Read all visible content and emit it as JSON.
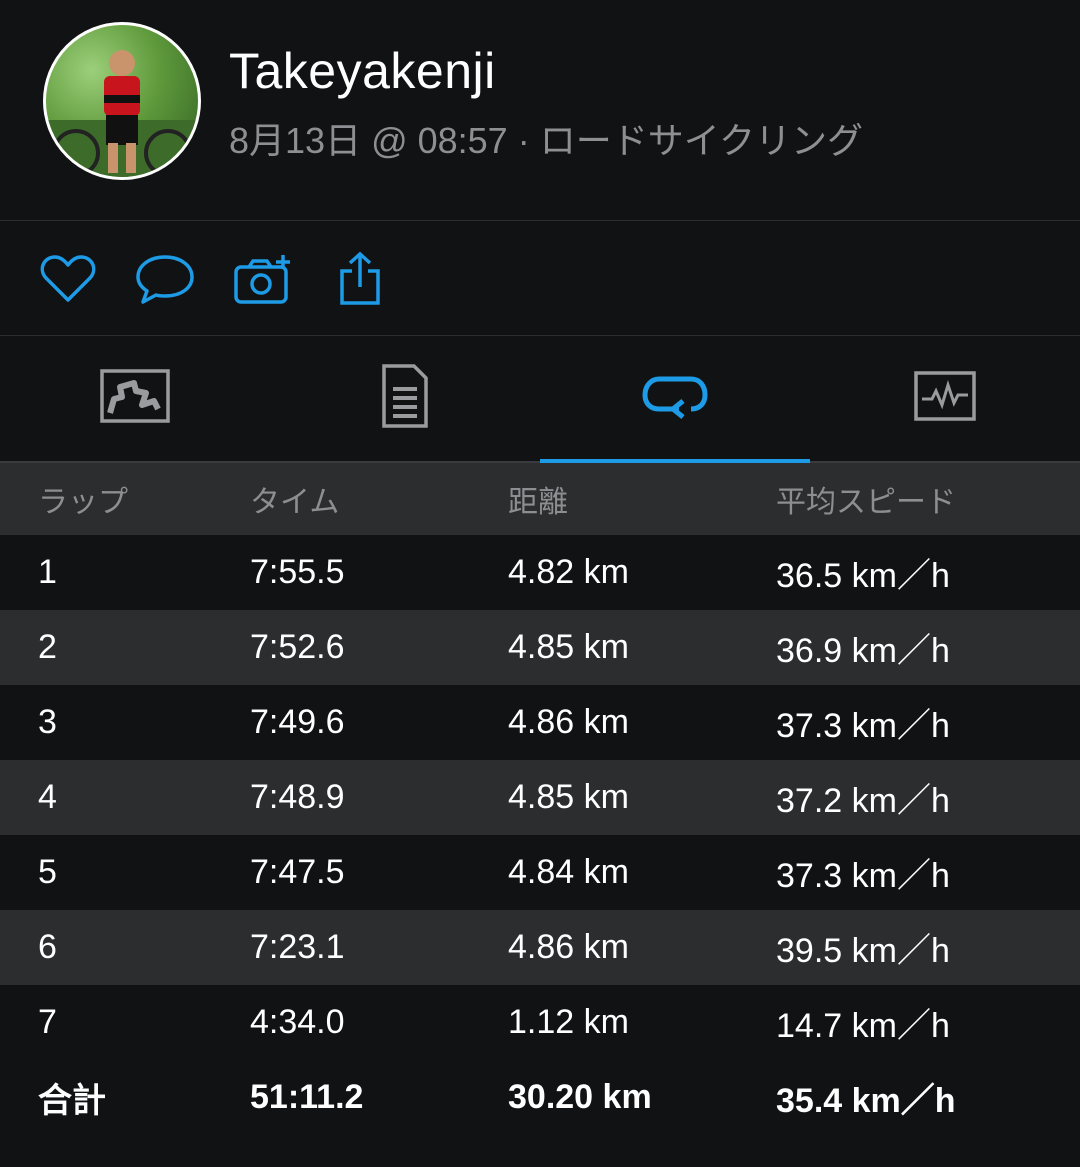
{
  "profile": {
    "username": "Takeyakenji",
    "subtitle": "8月13日 @ 08:57 · ロードサイクリング"
  },
  "actions": {
    "icons": [
      "heart-icon",
      "comment-icon",
      "add-photo-icon",
      "share-icon"
    ]
  },
  "tabs": {
    "icons": [
      "map-icon",
      "details-icon",
      "laps-icon",
      "graphs-icon"
    ],
    "active": "laps-icon"
  },
  "colors": {
    "accent": "#1e9be6",
    "background": "#111213",
    "row_alt": "#2c2d2f",
    "muted_text": "#8e8f93"
  },
  "laps": {
    "headers": [
      "ラップ",
      "タイム",
      "距離",
      "平均スピード"
    ],
    "rows": [
      [
        "1",
        "7:55.5",
        "4.82 km",
        "36.5 km／h"
      ],
      [
        "2",
        "7:52.6",
        "4.85 km",
        "36.9 km／h"
      ],
      [
        "3",
        "7:49.6",
        "4.86 km",
        "37.3 km／h"
      ],
      [
        "4",
        "7:48.9",
        "4.85 km",
        "37.2 km／h"
      ],
      [
        "5",
        "7:47.5",
        "4.84 km",
        "37.3 km／h"
      ],
      [
        "6",
        "7:23.1",
        "4.86 km",
        "39.5 km／h"
      ],
      [
        "7",
        "4:34.0",
        "1.12 km",
        "14.7 km／h"
      ]
    ],
    "total": [
      "合計",
      "51:11.2",
      "30.20 km",
      "35.4 km／h"
    ]
  }
}
